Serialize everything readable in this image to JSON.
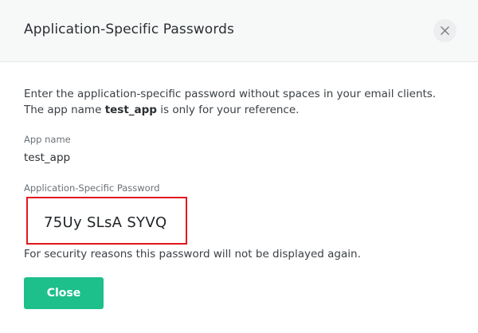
{
  "dialog": {
    "title": "Application-Specific Passwords",
    "close_icon": "close-icon",
    "intro_part1": "Enter the application-specific password without spaces in your email clients. The app name ",
    "intro_app_name": "test_app",
    "intro_part2": " is only for your reference.",
    "app_name_label": "App name",
    "app_name_value": "test_app",
    "password_label": "Application-Specific Password",
    "password_value": "75Uy SLsA SYVQ",
    "security_notice": "For security reasons this password will not be displayed again.",
    "close_button_label": "Close"
  },
  "colors": {
    "accent": "#1dbf8b",
    "highlight_border": "#e0191f",
    "header_bg": "#f7f8f8"
  }
}
